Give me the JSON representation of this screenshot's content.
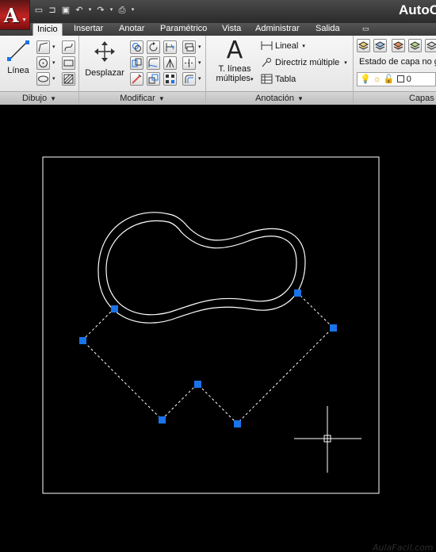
{
  "app": {
    "title": "AutoC",
    "logo_letter": "A"
  },
  "quick_access": [
    "new-icon",
    "open-icon",
    "save-icon",
    "undo-icon",
    "redo-icon",
    "plot-icon"
  ],
  "tabs": [
    {
      "label": "Inicio",
      "active": true
    },
    {
      "label": "Insertar"
    },
    {
      "label": "Anotar"
    },
    {
      "label": "Paramétrico"
    },
    {
      "label": "Vista"
    },
    {
      "label": "Administrar"
    },
    {
      "label": "Salida"
    }
  ],
  "panels": {
    "draw": {
      "title": "Dibujo",
      "line_label": "Línea"
    },
    "modify": {
      "title": "Modificar",
      "move_label": "Desplazar"
    },
    "annotation": {
      "title": "Anotación",
      "mtext_line1": "T. líneas",
      "mtext_line2": "múltiples",
      "linear_label": "Lineal",
      "multileader_label": "Directriz múltiple",
      "table_label": "Tabla"
    },
    "layers": {
      "title": "Capas",
      "layer_state": "Estado de capa no g",
      "current_layer": "0"
    }
  },
  "watermark": "AulaFacil.com",
  "colors": {
    "grip": "#1a73e8",
    "ribbon_bg": "#ececec",
    "app_red": "#c12222"
  }
}
